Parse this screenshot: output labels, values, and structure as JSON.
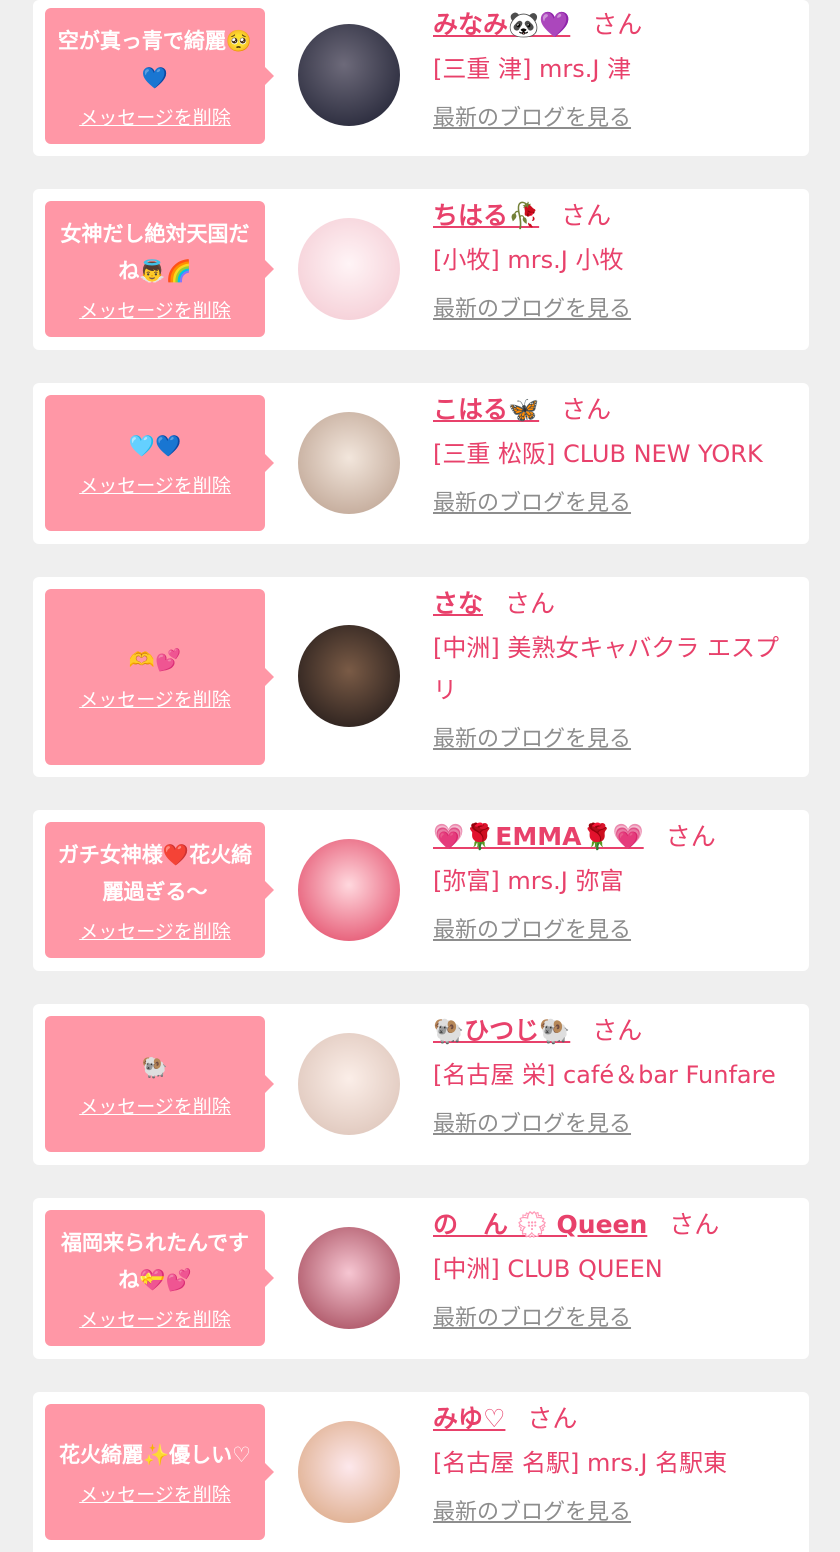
{
  "delete_label": "メッセージを削除",
  "blog_label": "最新のブログを見る",
  "honorific": "さん",
  "colors": {
    "bubble": "#ff97a6",
    "name": "#e8416b",
    "link_gray": "#8d8d8d",
    "background": "#efefef"
  },
  "items": [
    {
      "message": "空が真っ青で綺麗🥺💙",
      "name": "みなみ🐼💜",
      "shop": "[三重 津] mrs.J 津"
    },
    {
      "message": "女神だし絶対天国だね👼🌈",
      "name": "ちはる🥀",
      "shop": "[小牧] mrs.J 小牧"
    },
    {
      "message": "🩵💙",
      "name": "こはる🦋",
      "shop": "[三重 松阪] CLUB NEW YORK"
    },
    {
      "message": "🫶💕",
      "name": "さな",
      "shop": "[中洲] 美熟女キャバクラ エスプリ"
    },
    {
      "message": "ガチ女神様❤️花火綺麗過ぎる〜",
      "name": "💗🌹EMMA🌹💗",
      "shop": "[弥富] mrs.J 弥富"
    },
    {
      "message": "🐏",
      "name": "🐏ひつじ🐏",
      "shop": "[名古屋 栄] café＆bar Funfare"
    },
    {
      "message": "福岡来られたんですね💝💕",
      "name": "の　ん 💮 Queen",
      "shop": "[中洲] CLUB QUEEN"
    },
    {
      "message": "花火綺麗✨優しい♡",
      "name": "みゆ♡",
      "shop": "[名古屋 名駅] mrs.J 名駅東"
    }
  ]
}
